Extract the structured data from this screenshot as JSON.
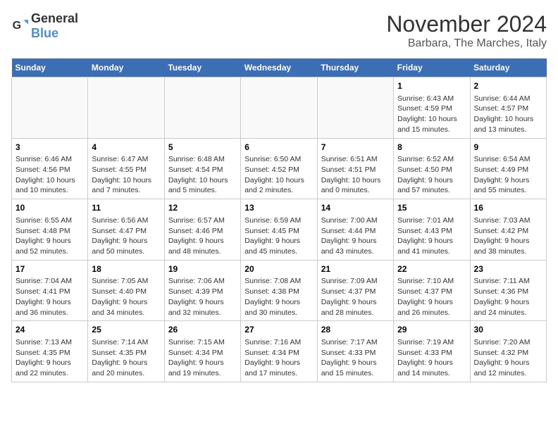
{
  "logo": {
    "general": "General",
    "blue": "Blue"
  },
  "title": "November 2024",
  "location": "Barbara, The Marches, Italy",
  "weekdays": [
    "Sunday",
    "Monday",
    "Tuesday",
    "Wednesday",
    "Thursday",
    "Friday",
    "Saturday"
  ],
  "weeks": [
    [
      {
        "day": "",
        "info": ""
      },
      {
        "day": "",
        "info": ""
      },
      {
        "day": "",
        "info": ""
      },
      {
        "day": "",
        "info": ""
      },
      {
        "day": "",
        "info": ""
      },
      {
        "day": "1",
        "info": "Sunrise: 6:43 AM\nSunset: 4:59 PM\nDaylight: 10 hours and 15 minutes."
      },
      {
        "day": "2",
        "info": "Sunrise: 6:44 AM\nSunset: 4:57 PM\nDaylight: 10 hours and 13 minutes."
      }
    ],
    [
      {
        "day": "3",
        "info": "Sunrise: 6:46 AM\nSunset: 4:56 PM\nDaylight: 10 hours and 10 minutes."
      },
      {
        "day": "4",
        "info": "Sunrise: 6:47 AM\nSunset: 4:55 PM\nDaylight: 10 hours and 7 minutes."
      },
      {
        "day": "5",
        "info": "Sunrise: 6:48 AM\nSunset: 4:54 PM\nDaylight: 10 hours and 5 minutes."
      },
      {
        "day": "6",
        "info": "Sunrise: 6:50 AM\nSunset: 4:52 PM\nDaylight: 10 hours and 2 minutes."
      },
      {
        "day": "7",
        "info": "Sunrise: 6:51 AM\nSunset: 4:51 PM\nDaylight: 10 hours and 0 minutes."
      },
      {
        "day": "8",
        "info": "Sunrise: 6:52 AM\nSunset: 4:50 PM\nDaylight: 9 hours and 57 minutes."
      },
      {
        "day": "9",
        "info": "Sunrise: 6:54 AM\nSunset: 4:49 PM\nDaylight: 9 hours and 55 minutes."
      }
    ],
    [
      {
        "day": "10",
        "info": "Sunrise: 6:55 AM\nSunset: 4:48 PM\nDaylight: 9 hours and 52 minutes."
      },
      {
        "day": "11",
        "info": "Sunrise: 6:56 AM\nSunset: 4:47 PM\nDaylight: 9 hours and 50 minutes."
      },
      {
        "day": "12",
        "info": "Sunrise: 6:57 AM\nSunset: 4:46 PM\nDaylight: 9 hours and 48 minutes."
      },
      {
        "day": "13",
        "info": "Sunrise: 6:59 AM\nSunset: 4:45 PM\nDaylight: 9 hours and 45 minutes."
      },
      {
        "day": "14",
        "info": "Sunrise: 7:00 AM\nSunset: 4:44 PM\nDaylight: 9 hours and 43 minutes."
      },
      {
        "day": "15",
        "info": "Sunrise: 7:01 AM\nSunset: 4:43 PM\nDaylight: 9 hours and 41 minutes."
      },
      {
        "day": "16",
        "info": "Sunrise: 7:03 AM\nSunset: 4:42 PM\nDaylight: 9 hours and 38 minutes."
      }
    ],
    [
      {
        "day": "17",
        "info": "Sunrise: 7:04 AM\nSunset: 4:41 PM\nDaylight: 9 hours and 36 minutes."
      },
      {
        "day": "18",
        "info": "Sunrise: 7:05 AM\nSunset: 4:40 PM\nDaylight: 9 hours and 34 minutes."
      },
      {
        "day": "19",
        "info": "Sunrise: 7:06 AM\nSunset: 4:39 PM\nDaylight: 9 hours and 32 minutes."
      },
      {
        "day": "20",
        "info": "Sunrise: 7:08 AM\nSunset: 4:38 PM\nDaylight: 9 hours and 30 minutes."
      },
      {
        "day": "21",
        "info": "Sunrise: 7:09 AM\nSunset: 4:37 PM\nDaylight: 9 hours and 28 minutes."
      },
      {
        "day": "22",
        "info": "Sunrise: 7:10 AM\nSunset: 4:37 PM\nDaylight: 9 hours and 26 minutes."
      },
      {
        "day": "23",
        "info": "Sunrise: 7:11 AM\nSunset: 4:36 PM\nDaylight: 9 hours and 24 minutes."
      }
    ],
    [
      {
        "day": "24",
        "info": "Sunrise: 7:13 AM\nSunset: 4:35 PM\nDaylight: 9 hours and 22 minutes."
      },
      {
        "day": "25",
        "info": "Sunrise: 7:14 AM\nSunset: 4:35 PM\nDaylight: 9 hours and 20 minutes."
      },
      {
        "day": "26",
        "info": "Sunrise: 7:15 AM\nSunset: 4:34 PM\nDaylight: 9 hours and 19 minutes."
      },
      {
        "day": "27",
        "info": "Sunrise: 7:16 AM\nSunset: 4:34 PM\nDaylight: 9 hours and 17 minutes."
      },
      {
        "day": "28",
        "info": "Sunrise: 7:17 AM\nSunset: 4:33 PM\nDaylight: 9 hours and 15 minutes."
      },
      {
        "day": "29",
        "info": "Sunrise: 7:19 AM\nSunset: 4:33 PM\nDaylight: 9 hours and 14 minutes."
      },
      {
        "day": "30",
        "info": "Sunrise: 7:20 AM\nSunset: 4:32 PM\nDaylight: 9 hours and 12 minutes."
      }
    ]
  ]
}
